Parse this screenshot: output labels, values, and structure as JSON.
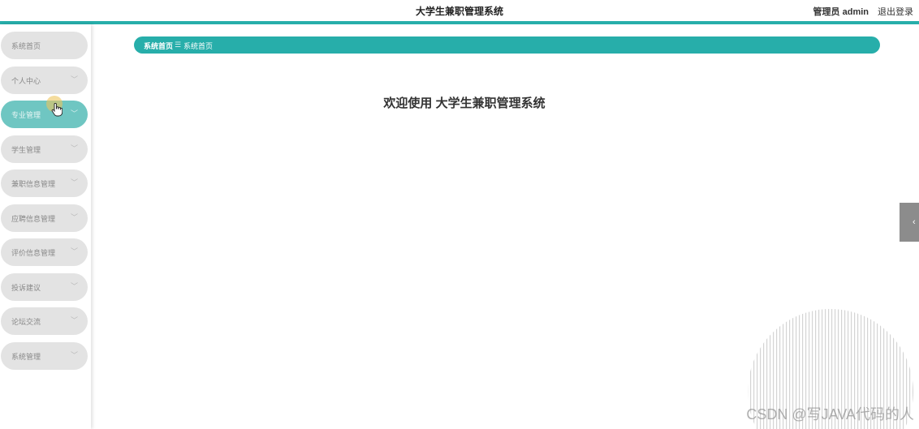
{
  "header": {
    "title": "大学生兼职管理系统",
    "user_label": "管理员 admin",
    "logout_label": "退出登录"
  },
  "sidebar": {
    "items": [
      {
        "label": "系统首页",
        "has_arrow": false
      },
      {
        "label": "个人中心",
        "has_arrow": true
      },
      {
        "label": "专业管理",
        "has_arrow": true,
        "active": true
      },
      {
        "label": "学生管理",
        "has_arrow": true
      },
      {
        "label": "兼职信息管理",
        "has_arrow": true
      },
      {
        "label": "应聘信息管理",
        "has_arrow": true
      },
      {
        "label": "评价信息管理",
        "has_arrow": true
      },
      {
        "label": "投诉建议",
        "has_arrow": true
      },
      {
        "label": "论坛交流",
        "has_arrow": true
      },
      {
        "label": "系统管理",
        "has_arrow": true
      }
    ]
  },
  "breadcrumb": {
    "home": "系统首页",
    "separator": "☰",
    "current": "系统首页"
  },
  "main": {
    "welcome": "欢迎使用 大学生兼职管理系统"
  },
  "side_tab": {
    "icon": "chevron-left-icon"
  },
  "watermark": "CSDN @写JAVA代码的人",
  "colors": {
    "accent": "#27aeaa",
    "active_item": "#6fc6c2",
    "inactive_item": "#e3e3e3"
  }
}
